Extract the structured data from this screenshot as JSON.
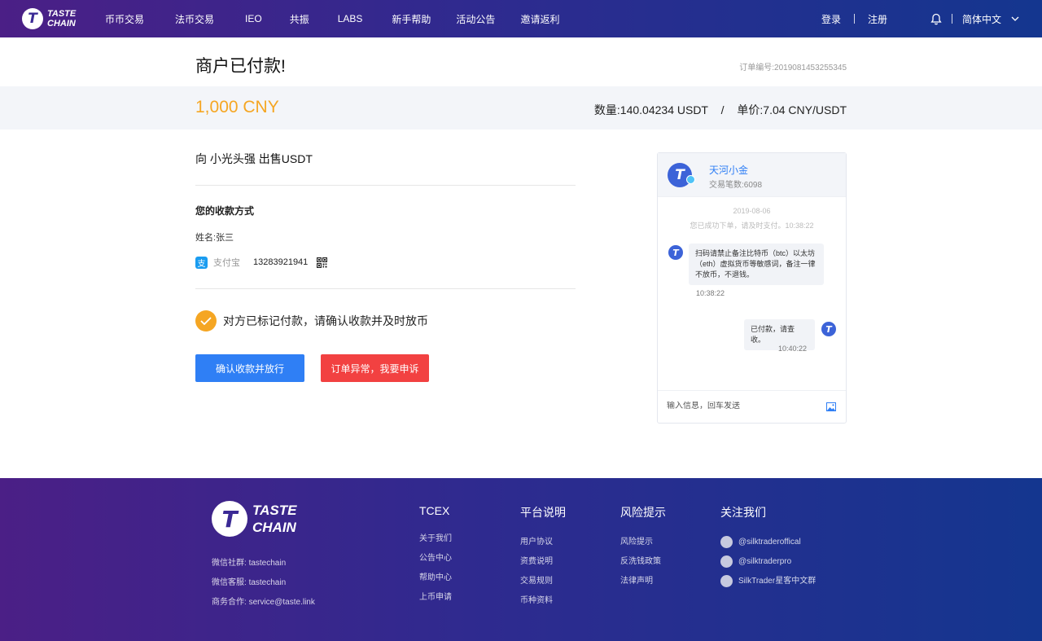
{
  "header": {
    "logo_line1": "TASTE",
    "logo_line2": "CHAIN",
    "logo_mark": "T",
    "nav": [
      "币币交易",
      "法币交易",
      "IEO",
      "共振",
      "LABS",
      "新手帮助",
      "活动公告",
      "邀请返利"
    ],
    "login": "登录",
    "register": "注册",
    "language": "简体中文",
    "bell_icon": "bell-icon",
    "chevron_icon": "chevron-down-icon"
  },
  "order": {
    "title": "商户已付款!",
    "order_no_label": "订单编号:",
    "order_no": "2019081453255345",
    "amount": "1,000 CNY",
    "qty_label": "数量:",
    "qty": "140.04234 USDT",
    "slash": "/",
    "price_label": "单价:",
    "price": "7.04 CNY/USDT",
    "to_seller": "向 小光头强 出售USDT"
  },
  "payment": {
    "title": "您的收款方式",
    "name_label": "姓名:",
    "name": "张三",
    "method_icon_glyph": "支",
    "method": "支付宝",
    "account": "13283921941",
    "confirm_text": "对方已标记付款，请确认收款并及时放币",
    "confirm_button": "确认收款并放行",
    "appeal_button": "订单异常，我要申诉",
    "colors": {
      "accent": "#f5a623",
      "primary": "#2f7ff5",
      "danger": "#f24141",
      "alipay": "#1a9cf0"
    }
  },
  "chat": {
    "name": "天河小金",
    "trades_label": "交易笔数:",
    "trades": "6098",
    "date": "2019-08-06",
    "system_msg": "您已成功下单，请及时支付。10:38:22",
    "messages": [
      {
        "side": "left",
        "text": "扫码请禁止备注比特币（btc）以太坊（eth）虚拟货币等敏感词，备注一律不放币，不退钱。",
        "time": "10:38:22"
      },
      {
        "side": "right",
        "text": "已付款，请查收。",
        "time": "10:40:22"
      }
    ],
    "input_placeholder": "输入信息，回车发送",
    "image_icon": "image-icon"
  },
  "footer": {
    "logo_line1": "TASTE",
    "logo_line2": "CHAIN",
    "logo_mark": "T",
    "info": [
      {
        "label": "微信社群:",
        "value": "tastechain"
      },
      {
        "label": "微信客服:",
        "value": "tastechain"
      },
      {
        "label": "商务合作:",
        "value": "service@taste.link"
      }
    ],
    "columns": [
      {
        "title": "TCEX",
        "links": [
          "关于我们",
          "公告中心",
          "帮助中心",
          "上币申请"
        ]
      },
      {
        "title": "平台说明",
        "links": [
          "用户协议",
          "资费说明",
          "交易规则",
          "币种资料"
        ]
      },
      {
        "title": "风险提示",
        "links": [
          "风险提示",
          "反洗钱政策",
          "法律声明"
        ]
      },
      {
        "title": "关注我们",
        "links": [
          "@silktraderoffical",
          "@silktraderpro",
          "SilkTrader星客中文群"
        ]
      }
    ]
  }
}
